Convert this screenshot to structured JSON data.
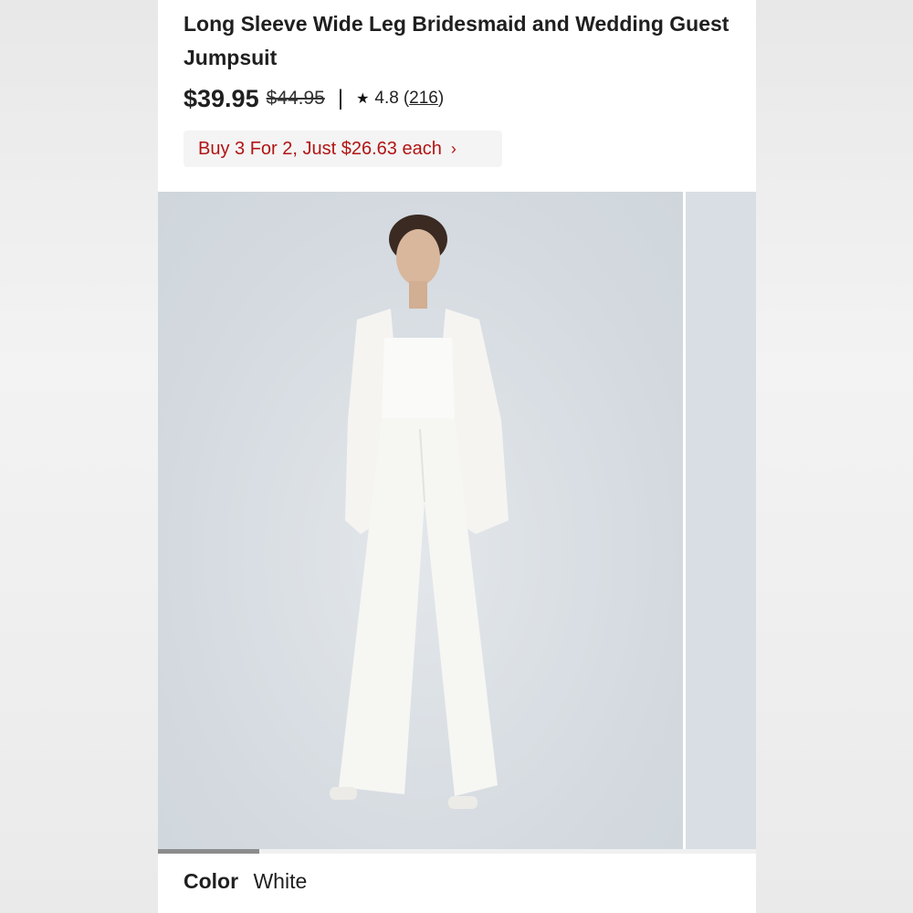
{
  "product": {
    "title": "Long Sleeve Wide Leg Bridesmaid and Wedding Guest Jumpsuit",
    "price": "$39.95",
    "original_price": "$44.95",
    "separator": "|",
    "rating": "4.8",
    "review_count": "216",
    "star_icon": "star-icon"
  },
  "promo": {
    "label": "Buy 3 For 2, Just $26.63 each",
    "text_color": "#b11414",
    "chevron": "chevron-right-icon"
  },
  "gallery": {
    "progress_fraction": 0.17
  },
  "color": {
    "label": "Color",
    "value": "White"
  }
}
